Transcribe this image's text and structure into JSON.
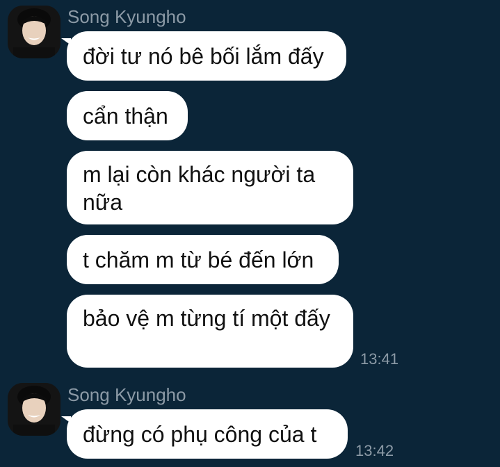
{
  "groups": [
    {
      "sender": "Song Kyungho",
      "messages": [
        "đời tư nó bê bối lắm đấy",
        "cẩn thận",
        "m lại còn khác người ta nữa",
        "t chăm m từ bé đến lớn",
        "bảo vệ m từng tí một đấy"
      ],
      "time": "13:41"
    },
    {
      "sender": "Song Kyungho",
      "messages": [
        "đừng có phụ công của t"
      ],
      "time": "13:42"
    }
  ],
  "colors": {
    "background": "#0b2538",
    "bubble": "#ffffff",
    "meta_text": "#8c9aa6"
  },
  "icons": {
    "avatar": "profile-photo"
  }
}
